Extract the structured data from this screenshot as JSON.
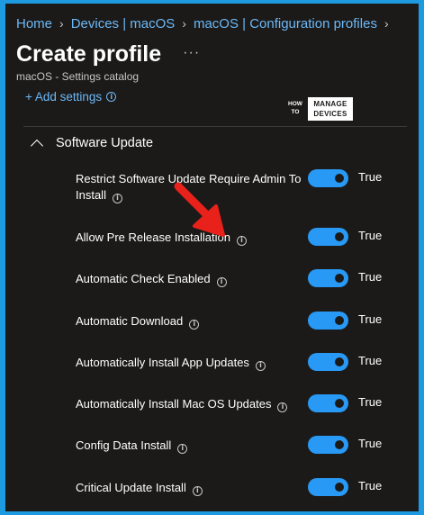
{
  "breadcrumb": [
    "Home",
    "Devices | macOS",
    "macOS | Configuration profiles"
  ],
  "page_title": "Create profile",
  "more_label": "···",
  "subtitle": "macOS - Settings catalog",
  "add_settings_label": "+ Add settings",
  "logo": {
    "line1": "HOW TO",
    "line2": "MANAGE DEVICES"
  },
  "section_title": "Software Update",
  "settings": [
    {
      "label": "Restrict Software Update Require Admin To Install",
      "value": "True"
    },
    {
      "label": "Allow Pre Release Installation",
      "value": "True"
    },
    {
      "label": "Automatic Check Enabled",
      "value": "True"
    },
    {
      "label": "Automatic Download",
      "value": "True"
    },
    {
      "label": "Automatically Install App Updates",
      "value": "True"
    },
    {
      "label": "Automatically Install Mac OS Updates",
      "value": "True"
    },
    {
      "label": "Config Data Install",
      "value": "True"
    },
    {
      "label": "Critical Update Install",
      "value": "True"
    }
  ],
  "colors": {
    "accent": "#2899f5",
    "link": "#6cb8f6",
    "background": "#1b1a19",
    "border": "#1e9be0",
    "annotation_arrow": "#e8211a"
  }
}
